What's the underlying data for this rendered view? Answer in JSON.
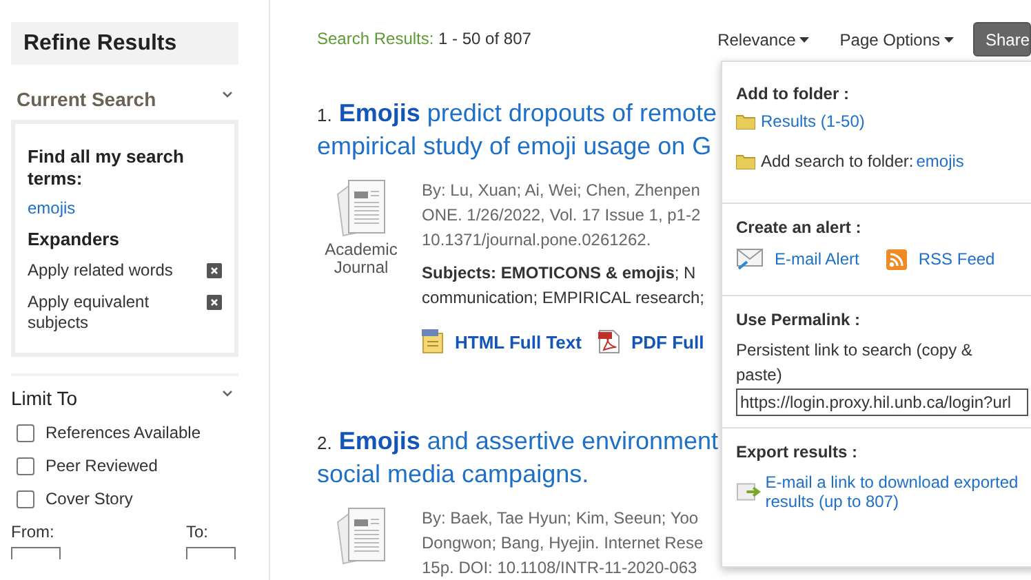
{
  "sidebar": {
    "title": "Refine Results",
    "current_search": {
      "heading": "Current Search",
      "expanded": true,
      "find_label": "Find all my search terms:",
      "term": "emojis",
      "expanders_heading": "Expanders",
      "expanders": [
        {
          "label": "Apply related words"
        },
        {
          "label": "Apply equivalent subjects"
        }
      ]
    },
    "limit_to": {
      "heading": "Limit To",
      "expanded": true,
      "options": [
        {
          "label": "References Available",
          "checked": false
        },
        {
          "label": "Peer Reviewed",
          "checked": false
        },
        {
          "label": "Cover Story",
          "checked": false
        }
      ],
      "from_label": "From:",
      "to_label": "To:"
    }
  },
  "results_header": {
    "label": "Search Results:",
    "range": "1 - 50 of 807"
  },
  "toolbar": [
    {
      "label": "Relevance",
      "kind": "menu"
    },
    {
      "label": "Page Options",
      "kind": "menu"
    },
    {
      "label": "Share",
      "kind": "button"
    }
  ],
  "results": [
    {
      "number": "1.",
      "title_lines": [
        "**Emojis** predict dropouts of remote",
        "empirical study of emoji usage on G"
      ],
      "type": "Academic Journal",
      "details": [
        "By: Lu, Xuan; Ai, Wei; Chen, Zhenpen",
        "ONE. 1/26/2022, Vol. 17 Issue 1, p1-2",
        "10.1371/journal.pone.0261262."
      ],
      "subjects": [
        "**Subjects: EMOTICONS & emojis**; N",
        "communication; EMPIRICAL research;"
      ],
      "links": [
        {
          "label": "HTML Full Text",
          "kind": "html"
        },
        {
          "label": "PDF Full",
          "kind": "pdf"
        }
      ]
    },
    {
      "number": "2.",
      "title_lines": [
        "**Emojis** and assertive environment",
        "social media campaigns."
      ],
      "details": [
        "By: Baek, Tae Hyun; Kim, Seeun; Yoo",
        "Dongwon; Bang, Hyejin. Internet Rese",
        "15p. DOI: 10.1108/INTR-11-2020-063"
      ]
    }
  ],
  "share_menu": {
    "sections": [
      {
        "heading": "Add to folder :",
        "kind": "folder",
        "items": [
          {
            "link": "Results (1-50)"
          },
          {
            "text": "Add search to folder:",
            "link": "emojis"
          }
        ]
      },
      {
        "heading": "Create an alert :",
        "kind": "alert",
        "items": [
          {
            "link": "E-mail Alert",
            "kind": "email"
          },
          {
            "link": "RSS Feed",
            "kind": "rss"
          }
        ]
      },
      {
        "heading": "Use Permalink :",
        "kind": "permalink",
        "description": "Persistent link to search (copy & paste)",
        "value": "https://login.proxy.hil.unb.ca/login?url"
      },
      {
        "heading": "Export results :",
        "kind": "export",
        "link": "E-mail a link to download exported results (up to 807)"
      }
    ]
  }
}
